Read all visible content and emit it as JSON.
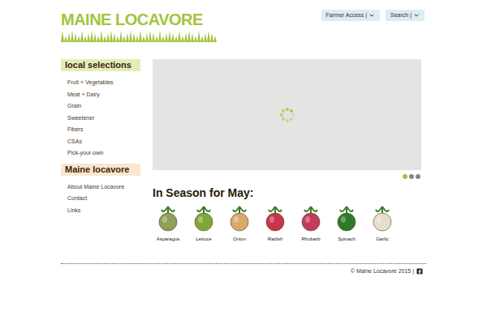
{
  "logo": {
    "text": "MAINE LOCAVORE"
  },
  "top_nav": [
    {
      "label": "Farmer Access |"
    },
    {
      "label": "Search |"
    }
  ],
  "sidebar": {
    "sections": [
      {
        "title": "local selections",
        "color": "#e2eeb8",
        "items": [
          "Fruit + Vegetables",
          "Meat + Dairy",
          "Grain",
          "Sweetener",
          "Fibers",
          "CSAs",
          "Pick-your-own"
        ]
      },
      {
        "title": "Maine locavore",
        "color": "#fde6cf",
        "items": [
          "About Maine Locavore",
          "Contact",
          "Links"
        ]
      }
    ]
  },
  "slideshow": {
    "loading": true,
    "dots": [
      {
        "selected": true
      },
      {
        "selected": false
      },
      {
        "selected": false
      }
    ]
  },
  "in_season": {
    "title": "In Season for May:",
    "items": [
      {
        "label": "Asparagus",
        "color": "#8fa05a"
      },
      {
        "label": "Lettuce",
        "color": "#7fa83a"
      },
      {
        "label": "Onion",
        "color": "#d9a86a"
      },
      {
        "label": "Radish",
        "color": "#c8344a"
      },
      {
        "label": "Rhubarb",
        "color": "#c23b5a"
      },
      {
        "label": "Spinach",
        "color": "#2f7a2a"
      },
      {
        "label": "Garlic",
        "color": "#e6ddd0"
      }
    ]
  },
  "footer": {
    "text": "© Maine Locavore 2015 |"
  }
}
